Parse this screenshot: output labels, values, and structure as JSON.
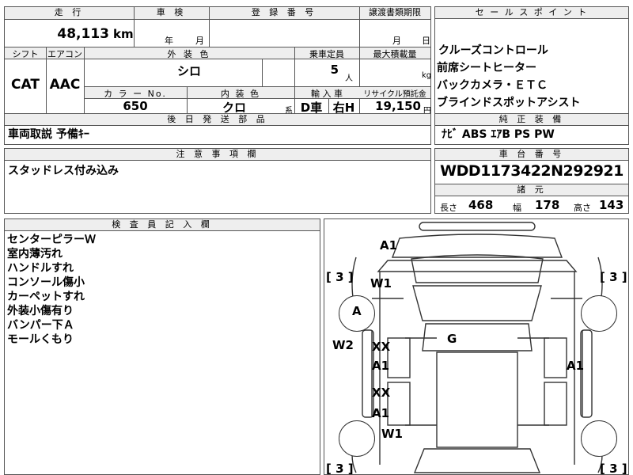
{
  "header": {
    "col_mileage": "走 行",
    "col_inspection": "車 検",
    "col_registration": "登 録 番 号",
    "col_transfer_docs": "譲渡書類期限",
    "col_sales_points": "セ ー ル ス ポ イ ン ト"
  },
  "vehicle": {
    "mileage": "48,113",
    "mileage_unit": "km",
    "inspection_year_unit": "年",
    "inspection_month_unit": "月",
    "transfer_month_unit": "月",
    "transfer_day_unit": "日",
    "shift_label": "シフト",
    "shift": "CAT",
    "ac_label": "エアコン",
    "ac": "AAC",
    "exterior_label": "外 装 色",
    "exterior_color": "シロ",
    "capacity_label": "乗車定員",
    "capacity": "5",
    "capacity_unit": "人",
    "max_load_label": "最大積載量",
    "max_load_unit": "kg",
    "color_no_label": "カ ラ ー No.",
    "color_no": "650",
    "interior_label": "内 装 色",
    "interior_color": "クロ",
    "interior_suffix": "系",
    "import_label": "輸 入 車",
    "import_type": "D車",
    "steering": "右H",
    "recycle_label": "リサイクル預託金",
    "recycle_fee": "19,150",
    "recycle_unit": "円"
  },
  "sales_points": [
    "クルーズコントロール",
    "前席シートヒーター",
    "バックカメラ・ＥＴＣ",
    "ブラインドスポットアシスト"
  ],
  "parts": {
    "label": "後 日 発 送 部 品",
    "value": "車両取説 予備ｷｰ"
  },
  "equipment": {
    "label": "純 正 装 備",
    "value": "ﾅﾋﾞ ABS ｴｱB PS PW"
  },
  "caution": {
    "label": "注 意 事 項 欄",
    "value": "スタッドレス付み込み"
  },
  "chassis": {
    "label": "車 台 番 号",
    "value": "WDD1173422N292921"
  },
  "dimensions": {
    "label": "諸 元",
    "length_label": "長さ",
    "length": "468",
    "width_label": "幅",
    "width": "178",
    "height_label": "高さ",
    "height": "143"
  },
  "inspector": {
    "label": "検 査 員 記 入 欄",
    "notes": [
      "センターピラーＷ",
      "室内薄汚れ",
      "ハンドルすれ",
      "コンソール傷小",
      "カーペットすれ",
      "外装小傷有り",
      "バンパー下Ａ",
      "モールくもり"
    ]
  },
  "diagram": {
    "marks": {
      "front_bumper": "A1",
      "windshield": "W1",
      "front_left_fender": "A",
      "left_window": "W2",
      "roof": "G",
      "left_front_door_1": "XX",
      "left_front_door_2": "A1",
      "left_rear_door_1": "XX",
      "left_rear_door_2": "A1",
      "right_front_door": "A1",
      "rear_window": "W1"
    },
    "tires": {
      "front_left": "[ 3 ]",
      "front_right": "[ 3 ]",
      "rear_left": "[ 3 ]",
      "rear_right": "[ 3 ]"
    }
  }
}
